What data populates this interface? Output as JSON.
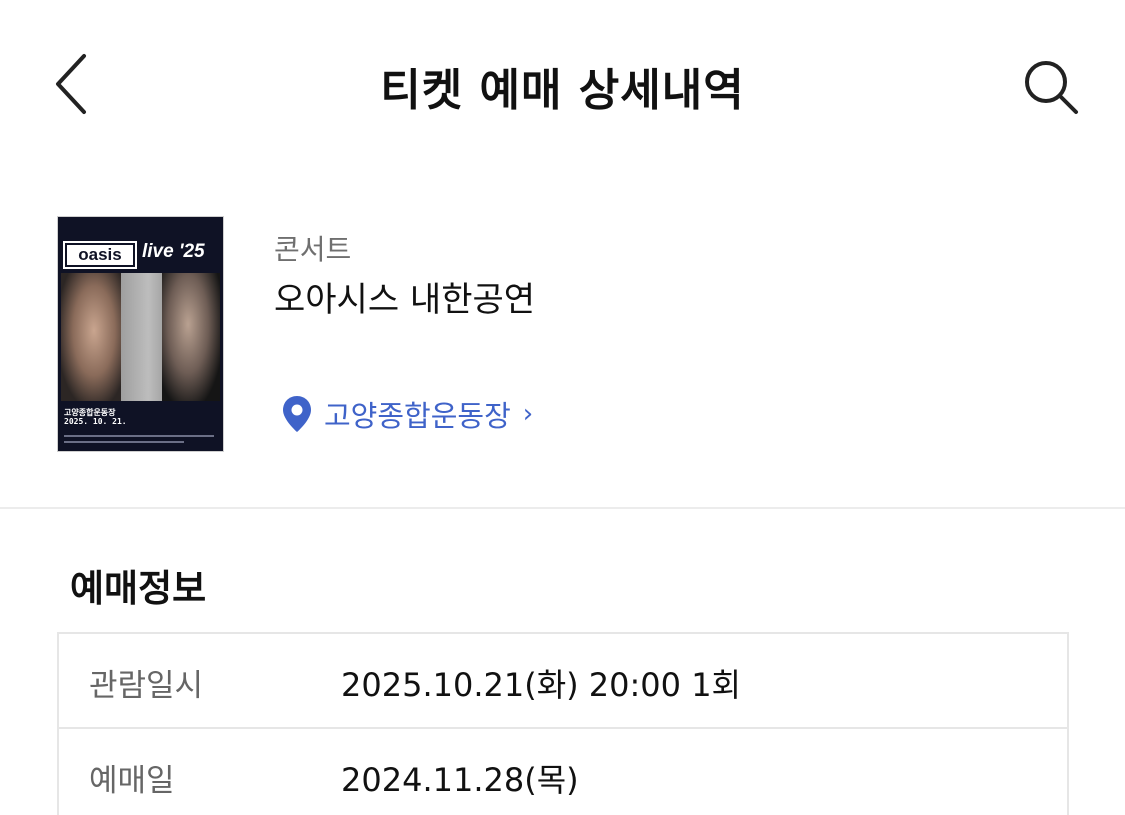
{
  "header": {
    "title": "티켓 예매 상세내역",
    "back_icon": "chevron-left-icon",
    "search_icon": "search-icon"
  },
  "event": {
    "poster": {
      "logo_text": "oasis",
      "tagline": "live '25",
      "venue_text": "고양종합운동장",
      "date_text": "2025. 10. 21."
    },
    "category": "콘서트",
    "title": "오아시스 내한공연",
    "venue": "고양종합운동장",
    "venue_icon": "location-pin-icon",
    "venue_chevron": "›"
  },
  "booking": {
    "section_title": "예매정보",
    "rows": [
      {
        "label": "관람일시",
        "value": "2025.10.21(화) 20:00 1회"
      },
      {
        "label": "예매일",
        "value": "2024.11.28(목)"
      }
    ]
  },
  "colors": {
    "accent_blue": "#3f63c9",
    "text_primary": "#111111",
    "text_secondary": "#6f6f6f",
    "divider": "#ececec"
  }
}
